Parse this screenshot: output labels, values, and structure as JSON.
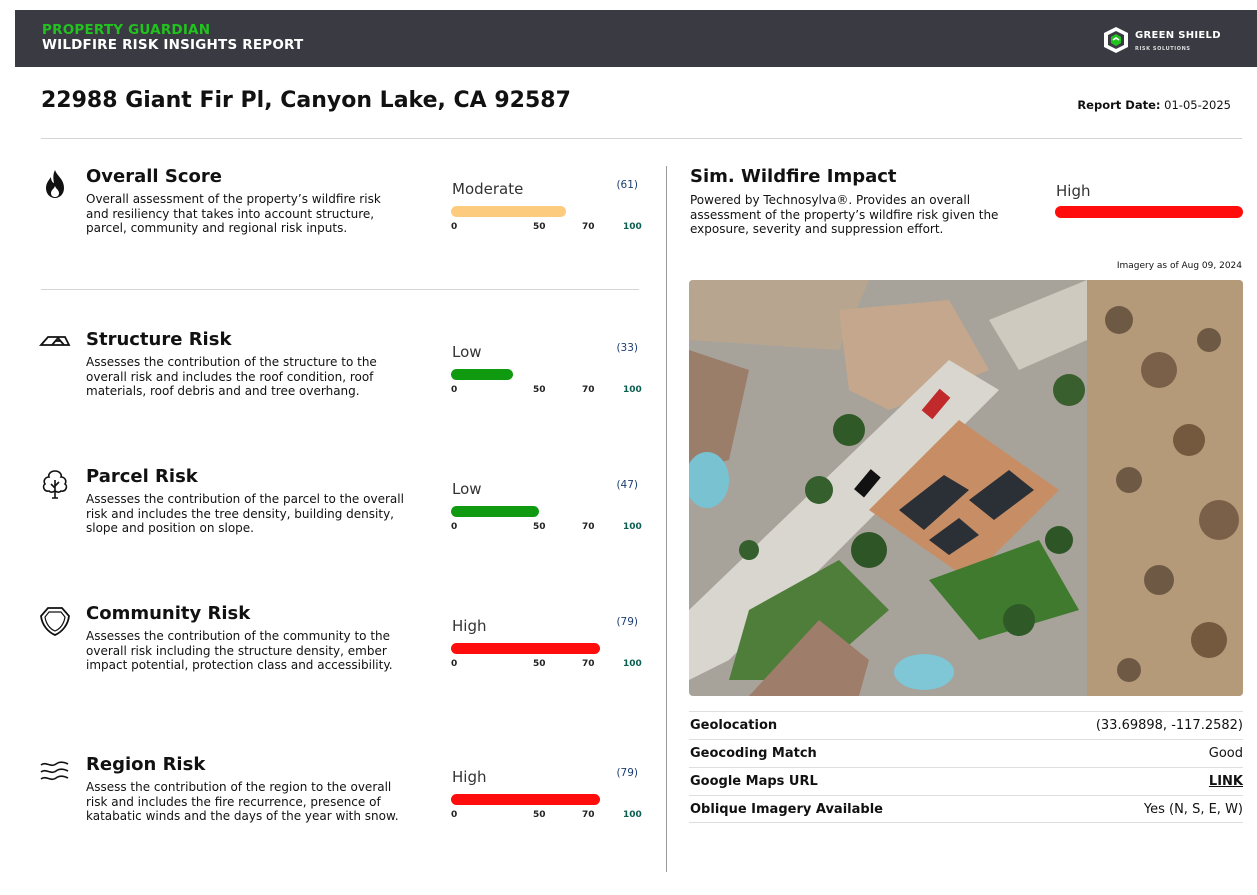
{
  "header": {
    "brand_line1": "PROPERTY GUARDIAN",
    "brand_line2": "WILDFIRE RISK INSIGHTS REPORT",
    "logo_name": "GREEN SHIELD",
    "logo_sub": "RISK SOLUTIONS",
    "colors": {
      "bar_bg": "#3a3a42",
      "brand_green": "#22c31e"
    }
  },
  "address": "22988 Giant Fir Pl, Canyon Lake, CA 92587",
  "report_date": {
    "label": "Report Date:",
    "value": "01-05-2025"
  },
  "scale_ticks": [
    "0",
    "50",
    "70",
    "100"
  ],
  "risks": [
    {
      "title": "Overall Score",
      "icon": "flame-icon",
      "description": "Overall assessment of the property’s wildfire risk and resiliency that takes into account structure, parcel, community and regional risk inputs.",
      "level": "Moderate",
      "score": "(61)",
      "score_value": 61,
      "color": "#fdcb7e"
    },
    {
      "title": "Structure Risk",
      "icon": "house-roof-icon",
      "description": "Assesses the contribution of the structure to the overall risk and includes the roof condition, roof materials, roof debris and and tree overhang.",
      "level": "Low",
      "score": "(33)",
      "score_value": 33,
      "color": "#0f9a0f"
    },
    {
      "title": "Parcel Risk",
      "icon": "tree-icon",
      "description": "Assesses the contribution of the parcel to the overall risk and includes the tree density, building density, slope and position on slope.",
      "level": "Low",
      "score": "(47)",
      "score_value": 47,
      "color": "#0f9a0f"
    },
    {
      "title": "Community Risk",
      "icon": "shield-icon",
      "description": "Assesses the contribution of the community to the overall risk including the structure density, ember impact potential, protection class and accessibility.",
      "level": "High",
      "score": "(79)",
      "score_value": 79,
      "color": "#ff0d0d"
    },
    {
      "title": "Region Risk",
      "icon": "wind-icon",
      "description": "Assess the contribution of the region to the overall risk and includes the fire recurrence, presence of katabatic winds and the days of the year with snow.",
      "level": "High",
      "score": "(79)",
      "score_value": 79,
      "color": "#ff0d0d"
    }
  ],
  "sim": {
    "title": "Sim. Wildfire Impact",
    "description": "Powered by Technosylva®. Provides an overall assessment of the property’s wildfire risk given the exposure, severity and suppression effort.",
    "level": "High",
    "color": "#ff0d0d"
  },
  "imagery_date": "Imagery as of Aug 09, 2024",
  "info": [
    {
      "key": "Geolocation",
      "value": "(33.69898, -117.2582)",
      "link": false
    },
    {
      "key": "Geocoding Match",
      "value": "Good",
      "link": false
    },
    {
      "key": "Google Maps URL",
      "value": "LINK",
      "link": true
    },
    {
      "key": "Oblique Imagery Available",
      "value": "Yes (N, S, E, W)",
      "link": false
    }
  ]
}
